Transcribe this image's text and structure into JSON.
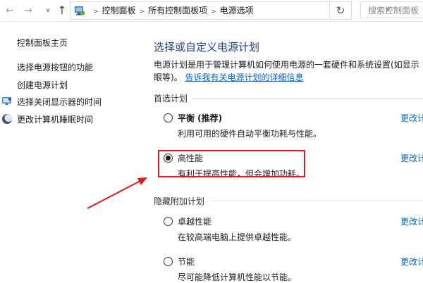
{
  "address_bar": {
    "back_glyph": "←",
    "forward_glyph": "→",
    "recent_glyph": "∨",
    "up_glyph": "↑",
    "breadcrumbs": [
      "控制面板",
      "所有控制面板项",
      "电源选项"
    ],
    "refresh_glyph": "↻",
    "search_placeholder": "搜索控制面板"
  },
  "sidebar": {
    "items": [
      {
        "label": "控制面板主页",
        "icon": null
      },
      {
        "label": "选择电源按钮的功能",
        "icon": null
      },
      {
        "label": "创建电源计划",
        "icon": null
      },
      {
        "label": "选择关闭显示器的时间",
        "icon": "monitor-icon"
      },
      {
        "label": "更改计算机睡眠时间",
        "icon": "moon-icon"
      }
    ]
  },
  "main": {
    "title": "选择或自定义电源计划",
    "description_line1": "电源计划是用于管理计算机如何使用电源的一套硬件和系统设置(如显示",
    "description_line2": "眼等)。",
    "description_link": "告诉我有关电源计划的详细信息",
    "preferred_group": "首选计划",
    "hidden_group": "隐藏附加计划",
    "change_link": "更改计",
    "plans": [
      {
        "name": "平衡 (推荐)",
        "desc": "利用可用的硬件自动平衡功耗与性能。",
        "selected": false
      },
      {
        "name": "高性能",
        "desc": "有利于提高性能，但会增加功耗。",
        "selected": true
      },
      {
        "name": "卓越性能",
        "desc": "在较高端电脑上提供卓越性能。",
        "selected": false
      },
      {
        "name": "节能",
        "desc": "尽可能降低计算机性能以节能。",
        "selected": false
      }
    ]
  },
  "colors": {
    "accent": "#1e3f8e",
    "link": "#0066cc",
    "highlight": "#e0191e"
  }
}
